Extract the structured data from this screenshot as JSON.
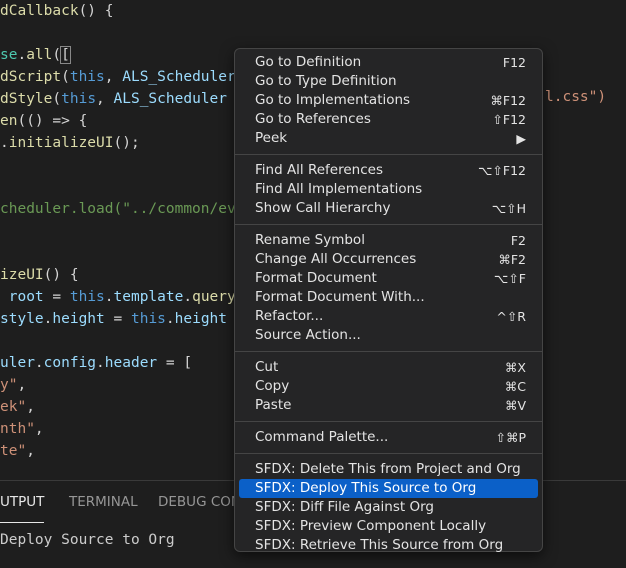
{
  "editor": {
    "lines": [
      [
        {
          "t": "dCallback",
          "c": "fn"
        },
        {
          "t": "() {",
          "c": "plain"
        }
      ],
      [],
      [
        {
          "t": "se",
          "c": "type"
        },
        {
          "t": ".",
          "c": "plain"
        },
        {
          "t": "all",
          "c": "fn"
        },
        {
          "t": "([",
          "c": "plain"
        }
      ],
      [
        {
          "t": "dScript",
          "c": "fn"
        },
        {
          "t": "(",
          "c": "plain"
        },
        {
          "t": "this",
          "c": "kw"
        },
        {
          "t": ", ",
          "c": "plain"
        },
        {
          "t": "ALS_Scheduler",
          "c": "prop"
        }
      ],
      [
        {
          "t": "dStyle",
          "c": "fn"
        },
        {
          "t": "(",
          "c": "plain"
        },
        {
          "t": "this",
          "c": "kw"
        },
        {
          "t": ", ",
          "c": "plain"
        },
        {
          "t": "ALS_Scheduler",
          "c": "prop"
        }
      ],
      [
        {
          "t": "en",
          "c": "fn"
        },
        {
          "t": "(() => {",
          "c": "plain"
        }
      ],
      [
        {
          "t": ".",
          "c": "plain"
        },
        {
          "t": "initializeUI",
          "c": "fn"
        },
        {
          "t": "();",
          "c": "plain"
        }
      ],
      [],
      [],
      [
        {
          "t": "cheduler.load(\"../common/ev",
          "c": "cmt"
        }
      ],
      [],
      [],
      [
        {
          "t": "izeUI",
          "c": "fn"
        },
        {
          "t": "() {",
          "c": "plain"
        }
      ],
      [
        {
          "t": " root",
          "c": "prop"
        },
        {
          "t": " = ",
          "c": "plain"
        },
        {
          "t": "this",
          "c": "kw"
        },
        {
          "t": ".",
          "c": "plain"
        },
        {
          "t": "template",
          "c": "prop"
        },
        {
          "t": ".",
          "c": "plain"
        },
        {
          "t": "query",
          "c": "fn"
        }
      ],
      [
        {
          "t": "style",
          "c": "prop"
        },
        {
          "t": ".",
          "c": "plain"
        },
        {
          "t": "height",
          "c": "prop"
        },
        {
          "t": " = ",
          "c": "plain"
        },
        {
          "t": "this",
          "c": "kw"
        },
        {
          "t": ".",
          "c": "plain"
        },
        {
          "t": "height",
          "c": "prop"
        }
      ],
      [],
      [
        {
          "t": "uler",
          "c": "prop"
        },
        {
          "t": ".",
          "c": "plain"
        },
        {
          "t": "config",
          "c": "prop"
        },
        {
          "t": ".",
          "c": "plain"
        },
        {
          "t": "header",
          "c": "prop"
        },
        {
          "t": " = [",
          "c": "plain"
        }
      ],
      [
        {
          "t": "y\"",
          "c": "str"
        },
        {
          "t": ",",
          "c": "plain"
        }
      ],
      [
        {
          "t": "ek\"",
          "c": "str"
        },
        {
          "t": ",",
          "c": "plain"
        }
      ],
      [
        {
          "t": "nth\"",
          "c": "str"
        },
        {
          "t": ",",
          "c": "plain"
        }
      ],
      [
        {
          "t": "te\"",
          "c": "str"
        },
        {
          "t": ",",
          "c": "plain"
        }
      ]
    ],
    "right_overflow_text": "l.css\")"
  },
  "panel": {
    "tabs": [
      "UTPUT",
      "TERMINAL",
      "DEBUG CON"
    ],
    "output_text": "Deploy Source to Org"
  },
  "context_menu": {
    "groups": [
      [
        {
          "label": "Go to Definition",
          "shortcut": "F12"
        },
        {
          "label": "Go to Type Definition",
          "shortcut": ""
        },
        {
          "label": "Go to Implementations",
          "shortcut": "⌘F12"
        },
        {
          "label": "Go to References",
          "shortcut": "⇧F12"
        },
        {
          "label": "Peek",
          "shortcut": "▶"
        }
      ],
      [
        {
          "label": "Find All References",
          "shortcut": "⌥⇧F12"
        },
        {
          "label": "Find All Implementations",
          "shortcut": ""
        },
        {
          "label": "Show Call Hierarchy",
          "shortcut": "⌥⇧H"
        }
      ],
      [
        {
          "label": "Rename Symbol",
          "shortcut": "F2"
        },
        {
          "label": "Change All Occurrences",
          "shortcut": "⌘F2"
        },
        {
          "label": "Format Document",
          "shortcut": "⌥⇧F"
        },
        {
          "label": "Format Document With...",
          "shortcut": ""
        },
        {
          "label": "Refactor...",
          "shortcut": "^⇧R"
        },
        {
          "label": "Source Action...",
          "shortcut": ""
        }
      ],
      [
        {
          "label": "Cut",
          "shortcut": "⌘X"
        },
        {
          "label": "Copy",
          "shortcut": "⌘C"
        },
        {
          "label": "Paste",
          "shortcut": "⌘V"
        }
      ],
      [
        {
          "label": "Command Palette...",
          "shortcut": "⇧⌘P"
        }
      ],
      [
        {
          "label": "SFDX: Delete This from Project and Org",
          "shortcut": ""
        },
        {
          "label": "SFDX: Deploy This Source to Org",
          "shortcut": "",
          "selected": true
        },
        {
          "label": "SFDX: Diff File Against Org",
          "shortcut": ""
        },
        {
          "label": "SFDX: Preview Component Locally",
          "shortcut": ""
        },
        {
          "label": "SFDX: Retrieve This Source from Org",
          "shortcut": ""
        }
      ]
    ]
  }
}
